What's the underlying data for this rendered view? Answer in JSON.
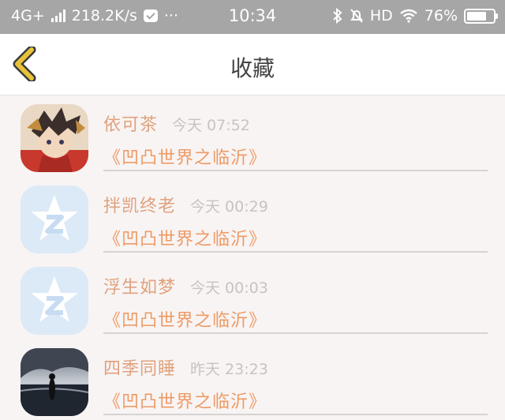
{
  "status_bar": {
    "network": "4G+",
    "speed": "218.2K/s",
    "more": "···",
    "time": "10:34",
    "hd": "HD",
    "battery_text": "76%",
    "battery_level": 0.76
  },
  "header": {
    "title": "收藏",
    "back_icon": "chevron-left-icon",
    "accent_color": "#e8c33a"
  },
  "favorites": [
    {
      "name": "依可茶",
      "time": "今天 07:52",
      "book": "《凹凸世界之临沂》",
      "avatar": "anime-avatar"
    },
    {
      "name": "拌凯终老",
      "time": "今天 00:29",
      "book": "《凹凸世界之临沂》",
      "avatar": "default-qq-avatar"
    },
    {
      "name": "浮生如梦",
      "time": "今天 00:03",
      "book": "《凹凸世界之临沂》",
      "avatar": "default-qq-avatar"
    },
    {
      "name": "四季同睡",
      "time": "昨天 23:23",
      "book": "《凹凸世界之临沂》",
      "avatar": "landscape-avatar"
    }
  ]
}
